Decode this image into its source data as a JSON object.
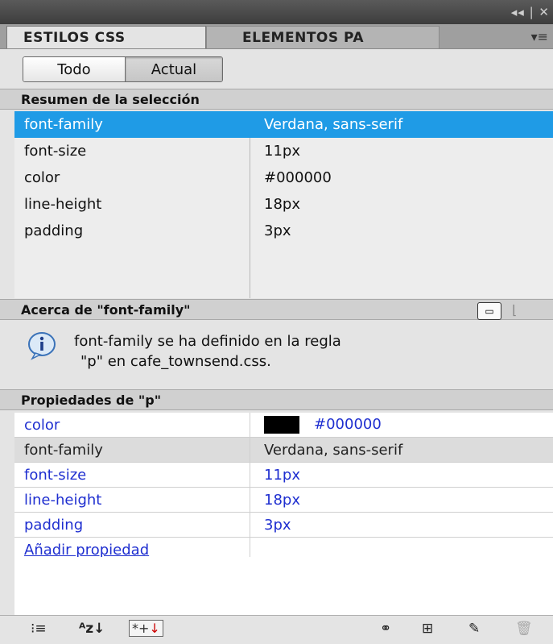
{
  "titlebar": {
    "controls": "◂◂ | ✕"
  },
  "tabs": [
    {
      "label": "ESTILOS CSS",
      "active": true
    },
    {
      "label": "ELEMENTOS PA",
      "active": false
    }
  ],
  "tab_menu_icon": "panel-menu-icon",
  "mode_buttons": {
    "todo": "Todo",
    "actual": "Actual",
    "selected": "Actual"
  },
  "summary": {
    "header": "Resumen de la selección",
    "rows": [
      {
        "property": "font-family",
        "value": "Verdana, sans-serif",
        "selected": true
      },
      {
        "property": "font-size",
        "value": "11px"
      },
      {
        "property": "color",
        "value": "#000000"
      },
      {
        "property": "line-height",
        "value": "18px"
      },
      {
        "property": "padding",
        "value": "3px"
      }
    ]
  },
  "about": {
    "header": "Acerca de \"font-family\"",
    "line1": "font-family se ha definido en la regla",
    "line2": "\"p\" en cafe_townsend.css."
  },
  "properties": {
    "header": "Propiedades de \"p\"",
    "rows": [
      {
        "property": "color",
        "value": "#000000",
        "swatch": "#000000"
      },
      {
        "property": "font-family",
        "value": "Verdana, sans-serif"
      },
      {
        "property": "font-size",
        "value": "11px"
      },
      {
        "property": "line-height",
        "value": "18px"
      },
      {
        "property": "padding",
        "value": "3px"
      }
    ],
    "add_label": "Añadir propiedad"
  },
  "toolbar": {
    "category_view": "⁝≡",
    "alpha_view": "ᴬᴢ↓",
    "set_view": "*+",
    "set_arrow": "↓",
    "icons": [
      "category-view-icon",
      "alpha-view-icon",
      "set-properties-icon",
      "attach-stylesheet-icon",
      "new-rule-icon",
      "edit-rule-icon",
      "delete-rule-icon"
    ]
  },
  "colors": {
    "selection": "#1f9be6",
    "link": "#1f2fd0"
  }
}
